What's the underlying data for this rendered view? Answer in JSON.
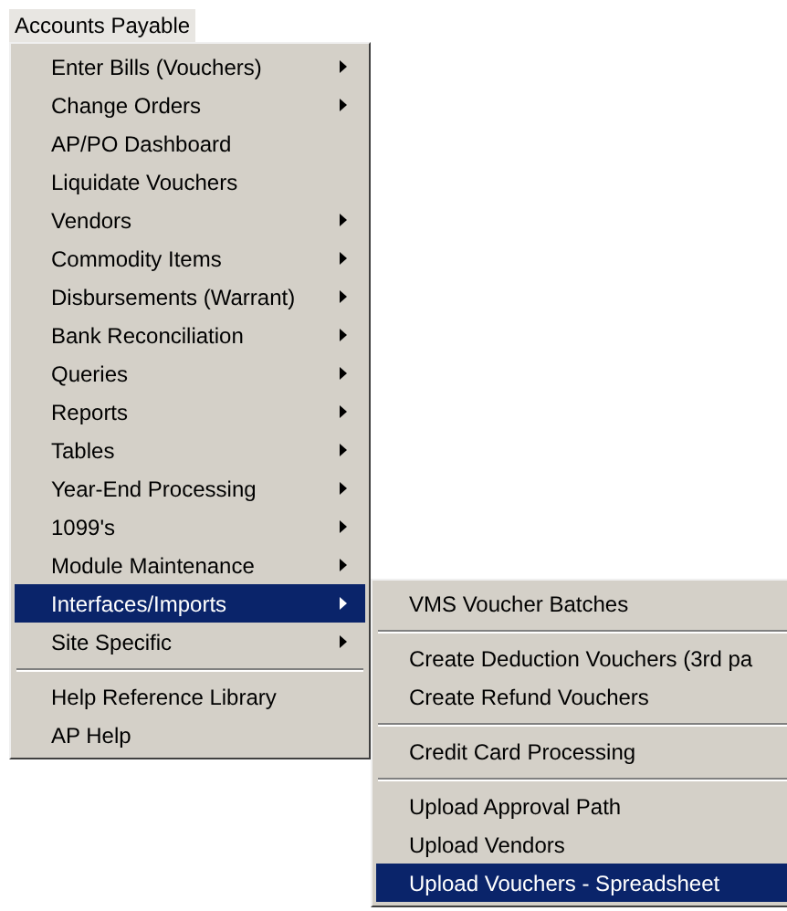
{
  "menu_title": "Accounts Payable",
  "menu": {
    "items": [
      {
        "kind": "item",
        "label": "Enter Bills (Vouchers)",
        "has_submenu": true,
        "selected": false
      },
      {
        "kind": "item",
        "label": "Change Orders",
        "has_submenu": true,
        "selected": false
      },
      {
        "kind": "item",
        "label": "AP/PO Dashboard",
        "has_submenu": false,
        "selected": false
      },
      {
        "kind": "item",
        "label": "Liquidate Vouchers",
        "has_submenu": false,
        "selected": false
      },
      {
        "kind": "item",
        "label": "Vendors",
        "has_submenu": true,
        "selected": false
      },
      {
        "kind": "item",
        "label": "Commodity Items",
        "has_submenu": true,
        "selected": false
      },
      {
        "kind": "item",
        "label": "Disbursements (Warrant)",
        "has_submenu": true,
        "selected": false
      },
      {
        "kind": "item",
        "label": "Bank Reconciliation",
        "has_submenu": true,
        "selected": false
      },
      {
        "kind": "item",
        "label": "Queries",
        "has_submenu": true,
        "selected": false
      },
      {
        "kind": "item",
        "label": "Reports",
        "has_submenu": true,
        "selected": false
      },
      {
        "kind": "item",
        "label": "Tables",
        "has_submenu": true,
        "selected": false
      },
      {
        "kind": "item",
        "label": "Year-End Processing",
        "has_submenu": true,
        "selected": false
      },
      {
        "kind": "item",
        "label": "1099's",
        "has_submenu": true,
        "selected": false
      },
      {
        "kind": "item",
        "label": "Module Maintenance",
        "has_submenu": true,
        "selected": false
      },
      {
        "kind": "item",
        "label": "Interfaces/Imports",
        "has_submenu": true,
        "selected": true
      },
      {
        "kind": "item",
        "label": "Site Specific",
        "has_submenu": true,
        "selected": false
      },
      {
        "kind": "separator"
      },
      {
        "kind": "item",
        "label": "Help Reference Library",
        "has_submenu": false,
        "selected": false
      },
      {
        "kind": "item",
        "label": "AP Help",
        "has_submenu": false,
        "selected": false
      }
    ]
  },
  "submenu": {
    "items": [
      {
        "kind": "item",
        "label": "VMS Voucher Batches",
        "has_submenu": false,
        "selected": false
      },
      {
        "kind": "separator"
      },
      {
        "kind": "item",
        "label": "Create Deduction Vouchers (3rd pa",
        "has_submenu": false,
        "selected": false
      },
      {
        "kind": "item",
        "label": "Create Refund Vouchers",
        "has_submenu": false,
        "selected": false
      },
      {
        "kind": "separator"
      },
      {
        "kind": "item",
        "label": "Credit Card Processing",
        "has_submenu": false,
        "selected": false
      },
      {
        "kind": "separator"
      },
      {
        "kind": "item",
        "label": "Upload Approval Path",
        "has_submenu": false,
        "selected": false
      },
      {
        "kind": "item",
        "label": "Upload Vendors",
        "has_submenu": false,
        "selected": false
      },
      {
        "kind": "item",
        "label": "Upload Vouchers - Spreadsheet",
        "has_submenu": false,
        "selected": true
      }
    ]
  }
}
